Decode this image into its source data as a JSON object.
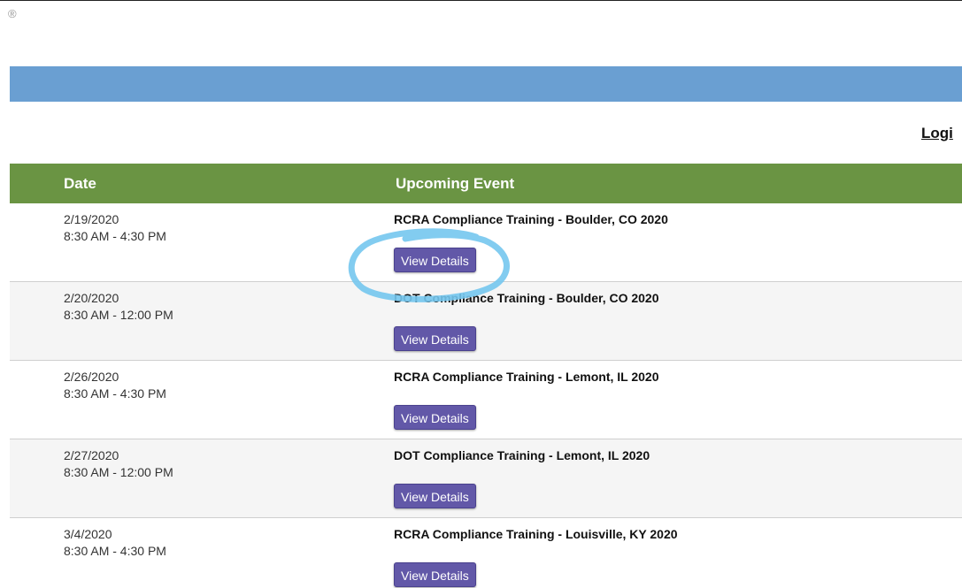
{
  "page": {
    "registered_symbol": "®",
    "login_label": "Logi"
  },
  "colors": {
    "banner": "#6a9fd2",
    "table_header": "#6a9443",
    "button": "#6258a8",
    "annotation": "#74c7ee"
  },
  "table": {
    "headers": {
      "date": "Date",
      "event": "Upcoming Event"
    },
    "rows": [
      {
        "date": "2/19/2020",
        "time": "8:30 AM - 4:30 PM",
        "event": "RCRA Compliance Training - Boulder, CO 2020",
        "button": "View Details"
      },
      {
        "date": "2/20/2020",
        "time": "8:30 AM - 12:00 PM",
        "event": "DOT Compliance Training - Boulder, CO 2020",
        "button": "View Details"
      },
      {
        "date": "2/26/2020",
        "time": "8:30 AM - 4:30 PM",
        "event": "RCRA Compliance Training - Lemont, IL 2020",
        "button": "View Details"
      },
      {
        "date": "2/27/2020",
        "time": "8:30 AM - 12:00 PM",
        "event": "DOT Compliance Training - Lemont, IL 2020",
        "button": "View Details"
      },
      {
        "date": "3/4/2020",
        "time": "8:30 AM - 4:30 PM",
        "event": "RCRA Compliance Training - Louisville, KY 2020",
        "button": "View Details"
      }
    ]
  }
}
